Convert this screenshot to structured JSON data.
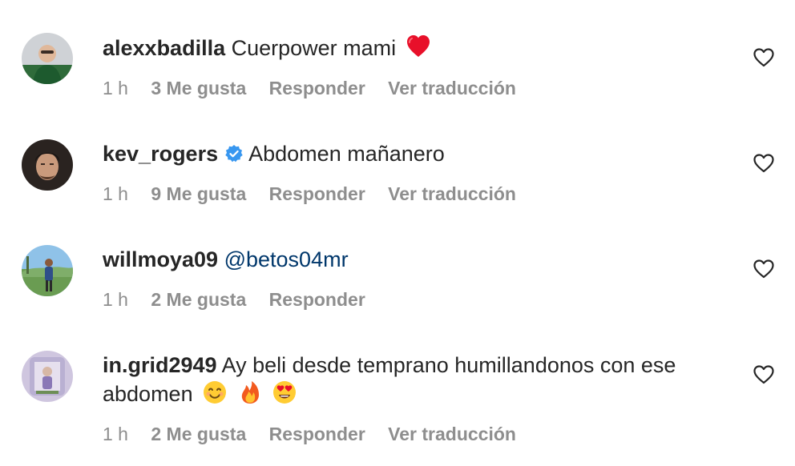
{
  "comments": [
    {
      "username": "alexxbadilla",
      "verified": false,
      "text": "Cuerpower mami",
      "emoji": [
        "red-heart"
      ],
      "time": "1 h",
      "likes": "3 Me gusta",
      "reply": "Responder",
      "translate": "Ver traducción"
    },
    {
      "username": "kev_rogers",
      "verified": true,
      "text": "Abdomen mañanero",
      "emoji": [],
      "time": "1 h",
      "likes": "9 Me gusta",
      "reply": "Responder",
      "translate": "Ver traducción"
    },
    {
      "username": "willmoya09",
      "verified": false,
      "mention": "@betos04mr",
      "time": "1 h",
      "likes": "2 Me gusta",
      "reply": "Responder"
    },
    {
      "username": "in.grid2949",
      "verified": false,
      "text": "Ay beli desde temprano humillandonos con ese abdomen",
      "emoji": [
        "smiling-face-icon",
        "fire-icon",
        "heart-eyes-icon"
      ],
      "time": "1 h",
      "likes": "2 Me gusta",
      "reply": "Responder",
      "translate": "Ver traducción"
    }
  ],
  "colors": {
    "text": "#262626",
    "secondary": "#8e8e8e",
    "mention": "#00376b",
    "verified": "#3897f0"
  }
}
